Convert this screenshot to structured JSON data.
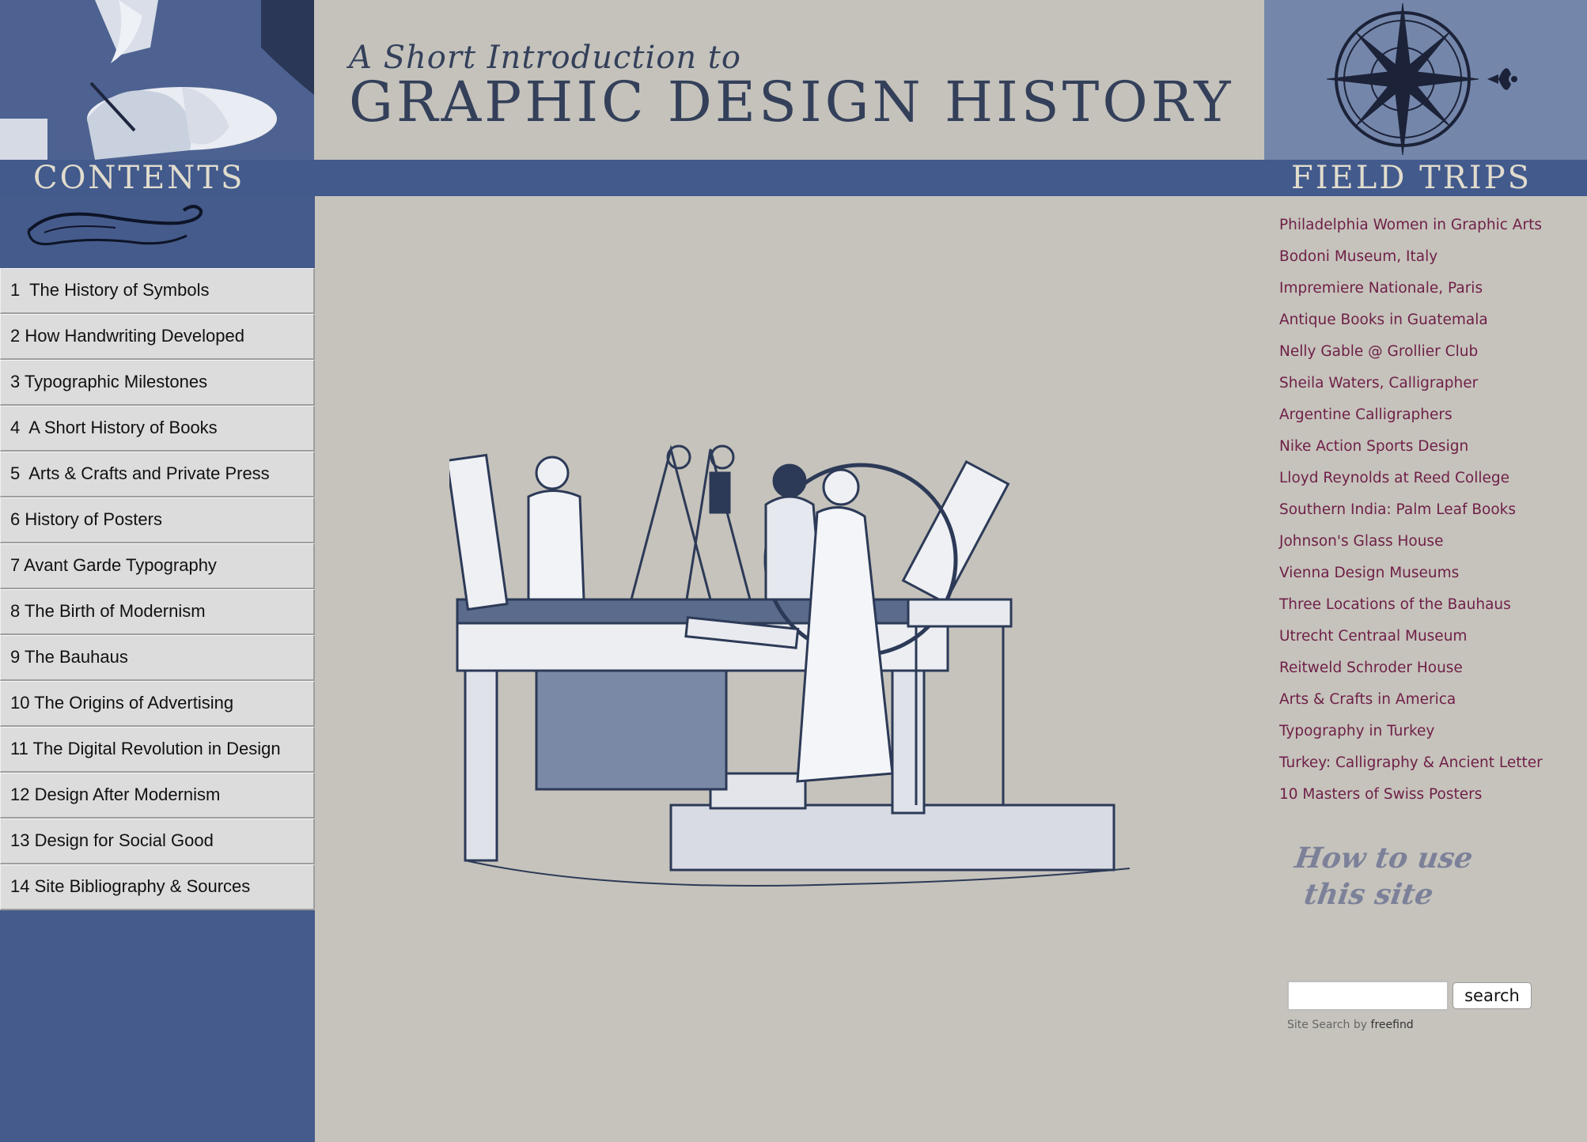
{
  "header": {
    "tagline": "A Short Introduction to",
    "title": "GRAPHIC DESIGN HISTORY"
  },
  "band": {
    "contents_title": "CONTENTS",
    "fieldtrips_title": "FIELD TRIPS"
  },
  "contents": [
    "1  The History of Symbols",
    "2 How Handwriting Developed",
    "3 Typographic Milestones",
    "4  A Short History of Books",
    "5  Arts & Crafts and Private Press",
    "6 History of Posters",
    "7 Avant Garde Typography",
    "8 The Birth of Modernism",
    "9 The Bauhaus",
    "10 The Origins of Advertising",
    "11 The Digital Revolution in Design",
    "12 Design After Modernism",
    "13 Design for Social Good",
    "14 Site Bibliography & Sources"
  ],
  "field_trips": [
    "Philadelphia Women in Graphic Arts",
    "Bodoni Museum, Italy",
    "Impremiere Nationale, Paris",
    "Antique Books in Guatemala",
    "Nelly Gable @ Grollier Club",
    "Sheila Waters, Calligrapher",
    "Argentine Calligraphers",
    "Nike Action Sports Design",
    "Lloyd Reynolds at Reed College",
    "Southern India: Palm Leaf Books",
    "Johnson's Glass House",
    "Vienna Design Museums",
    "Three Locations of the Bauhaus",
    "Utrecht Centraal Museum",
    "Reitweld Schroder House",
    "Arts & Crafts in America",
    "Typography in Turkey",
    "Turkey: Calligraphy & Ancient Letter",
    "10 Masters of Swiss Posters"
  ],
  "how_to": {
    "line1": "How to use",
    "line2": "this site"
  },
  "search": {
    "value": "",
    "button_label": "search",
    "credit_prefix": "Site Search by",
    "credit_brand": "freefind"
  },
  "colors": {
    "band_blue": "#425a8c",
    "background": "#c6c3bc",
    "link_maroon": "#6e1f47",
    "title_navy": "#34405a"
  },
  "icons": [
    "compass-rose-icon",
    "flourish-ornament-icon",
    "printing-press-illustration"
  ]
}
